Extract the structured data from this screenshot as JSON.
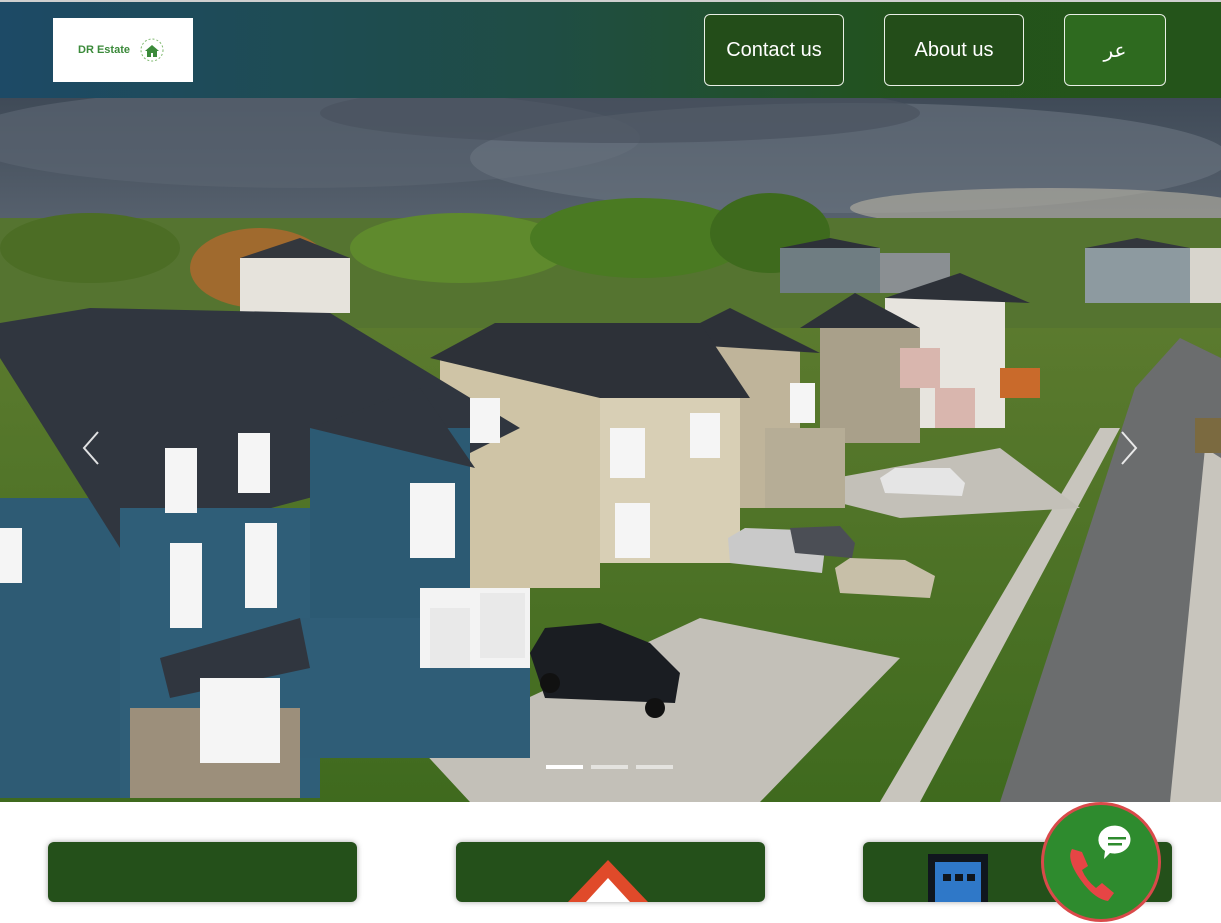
{
  "header": {
    "logo_text": "DR Estate",
    "nav": {
      "contact_label": "Contact us",
      "about_label": "About us",
      "language_label": "عر"
    }
  },
  "carousel": {
    "slide_count": 3,
    "active_index": 0,
    "prev_icon": "chevron-left-icon",
    "next_icon": "chevron-right-icon"
  },
  "feature_cards": [
    {
      "icon": "blank"
    },
    {
      "icon": "house-icon"
    },
    {
      "icon": "keyboard-icon"
    }
  ],
  "chat_button": {
    "icon": "phone-chat-icon"
  },
  "colors": {
    "header_start": "#1d4a66",
    "header_end": "#24541a",
    "button_bg": "#234d19",
    "card_bg": "#24501a",
    "chat_bg": "#2e8b2e",
    "chat_border": "#d94a4a"
  }
}
